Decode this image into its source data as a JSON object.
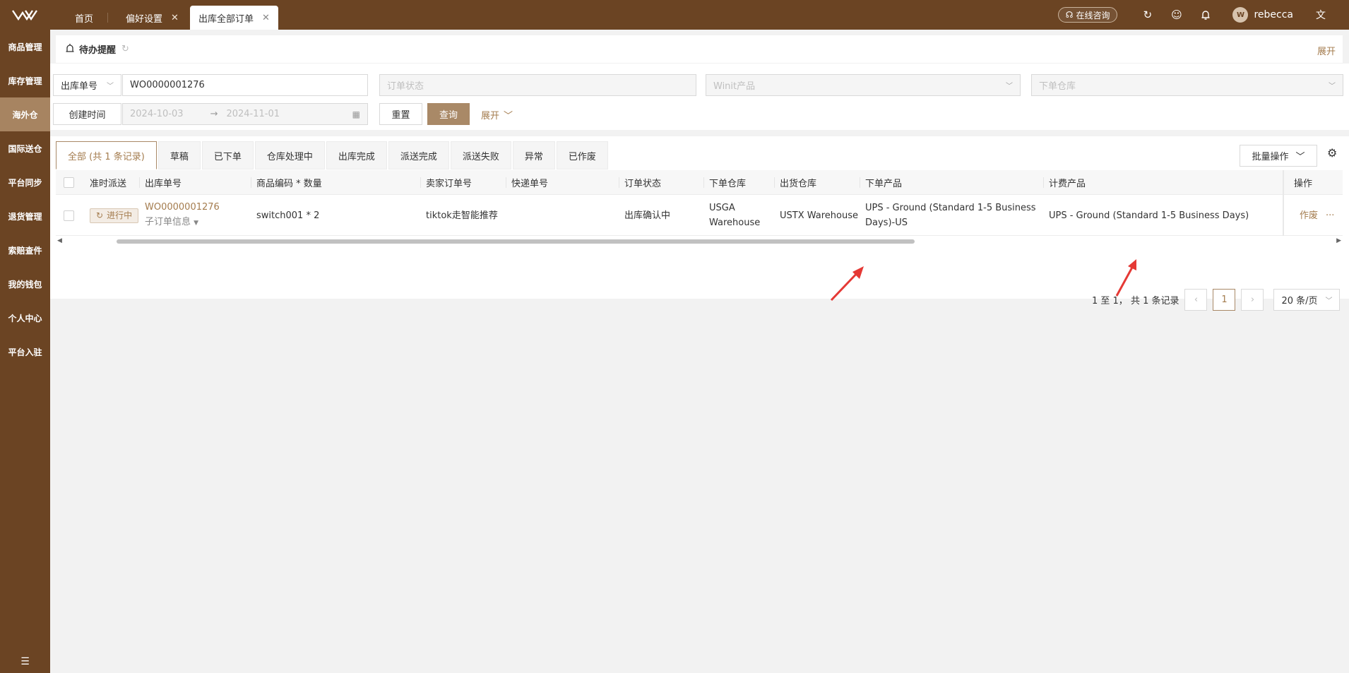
{
  "topbar": {
    "tabs": [
      {
        "label": "首页",
        "closable": false
      },
      {
        "label": "偏好设置",
        "closable": true
      },
      {
        "label": "出库全部订单",
        "closable": true,
        "active": true
      }
    ],
    "consult_label": "在线咨询",
    "username": "rebecca"
  },
  "sidebar": {
    "items": [
      "商品管理",
      "库存管理",
      "海外仓",
      "国际送仓",
      "平台同步",
      "退货管理",
      "索赔查件",
      "我的钱包",
      "个人中心",
      "平台入驻"
    ],
    "active_index": 2
  },
  "todo": {
    "title": "待办提醒",
    "expand": "展开"
  },
  "filters": {
    "order_type": "出库单号",
    "order_no": "WO0000001276",
    "status_placeholder": "订单状态",
    "product_placeholder": "Winit产品",
    "warehouse_placeholder": "下单仓库",
    "date_type": "创建时间",
    "date_start": "2024-10-03",
    "date_end": "2024-11-01",
    "reset": "重置",
    "query": "查询",
    "expand": "展开"
  },
  "status_tabs": [
    "全部 (共 1 条记录)",
    "草稿",
    "已下单",
    "仓库处理中",
    "出库完成",
    "派送完成",
    "派送失败",
    "异常",
    "已作废"
  ],
  "batch_label": "批量操作",
  "table": {
    "headers": [
      "准时派送",
      "出库单号",
      "商品编码 * 数量",
      "卖家订单号",
      "快递单号",
      "订单状态",
      "下单仓库",
      "出货仓库",
      "下单产品",
      "计费产品",
      "操作"
    ],
    "row": {
      "ontime": "进行中",
      "order_no": "WO0000001276",
      "sub_info": "子订单信息",
      "sku_qty": "switch001 * 2",
      "seller_order": "tiktok走智能推荐",
      "tracking": "",
      "status": "出库确认中",
      "order_warehouse": "USGA Warehouse",
      "ship_warehouse": "USTX Warehouse",
      "order_product": "UPS - Ground (Standard 1-5 Business Days)-US",
      "billing_product": "UPS - Ground (Standard 1-5 Business Days)",
      "action": "作废",
      "more": "···"
    }
  },
  "pagination": {
    "summary": "1 至 1， 共 1 条记录",
    "current": "1",
    "page_size": "20 条/页"
  },
  "colors": {
    "brand": "#6b4423",
    "accent": "#a47c4e",
    "annotation": "#e53935"
  }
}
